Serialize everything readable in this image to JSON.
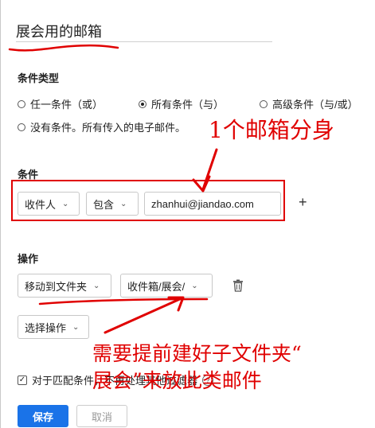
{
  "rule_name": "展会用的邮箱",
  "condition_type": {
    "label": "条件类型",
    "options": [
      {
        "label": "任一条件（或）",
        "checked": false
      },
      {
        "label": "所有条件（与）",
        "checked": true
      },
      {
        "label": "高级条件（与/或）",
        "checked": false
      },
      {
        "label": "没有条件。所有传入的电子邮件。",
        "checked": false
      }
    ]
  },
  "conditions": {
    "label": "条件",
    "field": "收件人",
    "operator": "包含",
    "value": "zhanhui@jiandao.com",
    "add_label": "+"
  },
  "actions": {
    "label": "操作",
    "action_type": "移动到文件夹",
    "folder": "收件箱/展会/",
    "select_action": "选择操作"
  },
  "options": {
    "no_more_filters_label": "对于匹配条件，不再处理其他过滤器",
    "no_more_filters_checked": true,
    "help": "?"
  },
  "footer": {
    "save_label": "保存",
    "cancel_label": "取消"
  },
  "annotations": {
    "alias_note": "1个邮箱分身",
    "folder_note_line1": "需要提前建好子文件夹“",
    "folder_note_line2": "展会”来放此类邮件",
    "color": "#e00000"
  },
  "icons": {
    "dropdown": "chevron-down-icon",
    "delete": "trash-icon",
    "checkbox": "checkmark-icon"
  },
  "colors": {
    "primary_button": "#1a73e8",
    "annotation_red": "#e00000"
  }
}
